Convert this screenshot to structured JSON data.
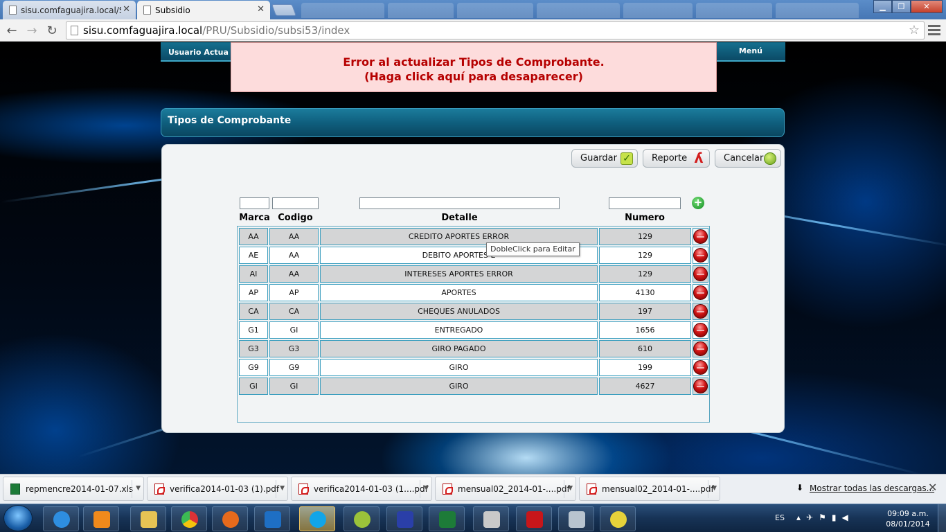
{
  "browser": {
    "tabs": [
      {
        "title": "sisu.comfaguajira.local/SY",
        "active": false
      },
      {
        "title": "Subsidio",
        "active": true
      }
    ],
    "url_host": "sisu.comfaguajira.local",
    "url_path": "/PRU/Subsidio/subsi53/index"
  },
  "app": {
    "usuario_label": "Usuario Actua",
    "menu_label": "Menú"
  },
  "error": {
    "line1": "Error al actualizar Tipos de Comprobante.",
    "line2": "(Haga click aquí para desaparecer)"
  },
  "section_title": "Tipos de Comprobante",
  "buttons": {
    "guardar": "Guardar",
    "reporte": "Reporte",
    "cancelar": "Cancelar"
  },
  "table": {
    "headers": [
      "Marca",
      "Codigo",
      "Detalle",
      "Numero"
    ],
    "rows": [
      {
        "marca": "AA",
        "codigo": "AA",
        "detalle": "CREDITO APORTES ERROR",
        "numero": "129"
      },
      {
        "marca": "AE",
        "codigo": "AA",
        "detalle": "DEBITO APORTES E",
        "numero": "129"
      },
      {
        "marca": "AI",
        "codigo": "AA",
        "detalle": "INTERESES APORTES ERROR",
        "numero": "129"
      },
      {
        "marca": "AP",
        "codigo": "AP",
        "detalle": "APORTES",
        "numero": "4130"
      },
      {
        "marca": "CA",
        "codigo": "CA",
        "detalle": "CHEQUES ANULADOS",
        "numero": "197"
      },
      {
        "marca": "G1",
        "codigo": "GI",
        "detalle": "ENTREGADO",
        "numero": "1656"
      },
      {
        "marca": "G3",
        "codigo": "G3",
        "detalle": "GIRO PAGADO",
        "numero": "610"
      },
      {
        "marca": "G9",
        "codigo": "G9",
        "detalle": "GIRO",
        "numero": "199"
      },
      {
        "marca": "GI",
        "codigo": "GI",
        "detalle": "GIRO",
        "numero": "4627"
      }
    ]
  },
  "tooltip": "DobleClick para Editar",
  "downloads": {
    "items": [
      {
        "name": "repmencre2014-01-07.xls",
        "type": "xls"
      },
      {
        "name": "verifica2014-01-03 (1).pdf",
        "type": "pdf"
      },
      {
        "name": "verifica2014-01-03 (1....pdf",
        "type": "pdf"
      },
      {
        "name": "mensual02_2014-01-....pdf",
        "type": "pdf"
      },
      {
        "name": "mensual02_2014-01-....pdf",
        "type": "pdf"
      }
    ],
    "show_all": "Mostrar todas las descargas..."
  },
  "taskbar": {
    "language": "ES",
    "time": "09:09 a.m.",
    "date": "08/01/2014"
  },
  "colors": {
    "accent": "#0f5f7e",
    "error_text": "#b60000",
    "error_bg": "#fddcdc",
    "row_alt": "#d4d5d6"
  }
}
